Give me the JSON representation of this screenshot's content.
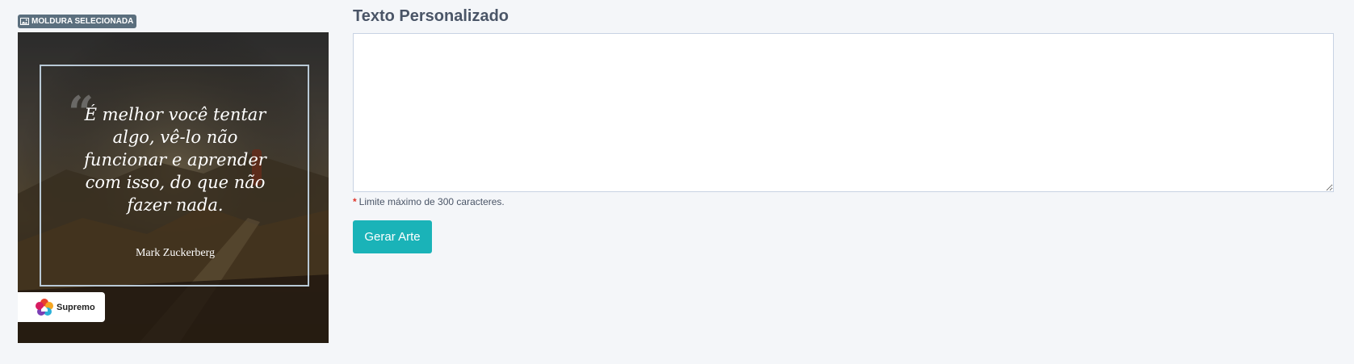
{
  "selected_frame": {
    "badge_label": "MOLDURA SELECIONADA",
    "badge_icon": "image-icon",
    "quote_mark": "“",
    "quote_text": "É melhor você tentar algo, vê-lo não funcionar e aprender com isso, do que não fazer nada.",
    "quote_author": "Mark Zuckerberg",
    "logo_name": "Supremo",
    "colors": {
      "border": "#b9c9d6",
      "badge_bg": "#5b6f7e"
    }
  },
  "form": {
    "title": "Texto Personalizado",
    "textarea_value": "",
    "hint_marker": "*",
    "hint_text": "Limite máximo de 300 caracteres.",
    "submit_label": "Gerar Arte",
    "colors": {
      "button": "#1ab3b8",
      "required": "#e0352b"
    }
  }
}
